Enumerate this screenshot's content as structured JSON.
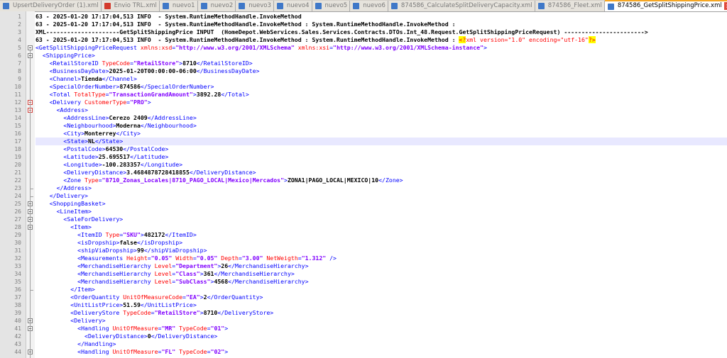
{
  "tabs": [
    {
      "label": "UpsertDeliveryOrder (1).xml",
      "state": "saved"
    },
    {
      "label": "Envio TRL.xml",
      "state": "dirty"
    },
    {
      "label": "nuevo1",
      "state": "saved"
    },
    {
      "label": "nuevo2",
      "state": "saved"
    },
    {
      "label": "nuevo3",
      "state": "saved"
    },
    {
      "label": "nuevo4",
      "state": "saved"
    },
    {
      "label": "nuevo5",
      "state": "saved"
    },
    {
      "label": "nuevo6",
      "state": "saved"
    },
    {
      "label": "874586_CalculateSplitDeliveryCapacity.xml",
      "state": "saved"
    },
    {
      "label": "874586_Fleet.xml",
      "state": "saved"
    },
    {
      "label": "874586_GetSplitShippingPrice.xml",
      "state": "saved",
      "active": true
    }
  ],
  "editor": {
    "highlighted_line": 17,
    "lines": [
      [
        {
          "c": "plain",
          "t": "63 - 2025-01-20 17:17:04,513 INFO  - System.RuntimeMethodHandle.InvokeMethod"
        }
      ],
      [
        {
          "c": "plain",
          "t": "63 - 2025-01-20 17:17:04,513 INFO  - System.RuntimeMethodHandle.InvokeMethod : System.RuntimeMethodHandle.InvokeMethod :"
        }
      ],
      [
        {
          "c": "plain",
          "t": "XML---------------------GetSplitShippingPrice INPUT  (HomeDepot.WebServices.Sales.Services.Contracts.DTOs.Int_48.Request.GetSplitShippingPriceRequest) ----------------------->"
        }
      ],
      [
        {
          "c": "plain",
          "t": "63 - 2025-01-20 17:17:04,513 INFO  - System.RuntimeMethodHandle.InvokeMethod : System.RuntimeMethodHandle.InvokeMethod : "
        },
        {
          "c": "pi",
          "t": "<?"
        },
        {
          "c": "pitxt",
          "t": "xml version=\"1.0\" encoding=\"utf-16\""
        },
        {
          "c": "pi",
          "t": "?>"
        }
      ],
      [
        {
          "c": "tag",
          "t": "<GetSplitShippingPriceRequest "
        },
        {
          "c": "attr",
          "t": "xmlns:xsd"
        },
        {
          "c": "tag",
          "t": "="
        },
        {
          "c": "val",
          "t": "\"http://www.w3.org/2001/XMLSchema\""
        },
        {
          "c": "attr",
          "t": " xmlns:xsi"
        },
        {
          "c": "tag",
          "t": "="
        },
        {
          "c": "val",
          "t": "\"http://www.w3.org/2001/XMLSchema-instance\""
        },
        {
          "c": "tag",
          "t": ">"
        }
      ],
      [
        {
          "c": "tag",
          "t": "  <ShippingPrice>"
        }
      ],
      [
        {
          "c": "tag",
          "t": "    <RetailStoreID "
        },
        {
          "c": "attr",
          "t": "TypeCode"
        },
        {
          "c": "tag",
          "t": "="
        },
        {
          "c": "val",
          "t": "\"RetailStore\""
        },
        {
          "c": "tag",
          "t": ">"
        },
        {
          "c": "text",
          "t": "8710"
        },
        {
          "c": "tag",
          "t": "</RetailStoreID>"
        }
      ],
      [
        {
          "c": "tag",
          "t": "    <BusinessDayDate>"
        },
        {
          "c": "text",
          "t": "2025-01-20T00:00:00-06:00"
        },
        {
          "c": "tag",
          "t": "</BusinessDayDate>"
        }
      ],
      [
        {
          "c": "tag",
          "t": "    <Channel>"
        },
        {
          "c": "text",
          "t": "Tienda"
        },
        {
          "c": "tag",
          "t": "</Channel>"
        }
      ],
      [
        {
          "c": "tag",
          "t": "    <SpecialOrderNumber>"
        },
        {
          "c": "text",
          "t": "874586"
        },
        {
          "c": "tag",
          "t": "</SpecialOrderNumber>"
        }
      ],
      [
        {
          "c": "tag",
          "t": "    <Total "
        },
        {
          "c": "attr",
          "t": "TotalType"
        },
        {
          "c": "tag",
          "t": "="
        },
        {
          "c": "val",
          "t": "\"TransactionGrandAmount\""
        },
        {
          "c": "tag",
          "t": ">"
        },
        {
          "c": "text",
          "t": "3892.28"
        },
        {
          "c": "tag",
          "t": "</Total>"
        }
      ],
      [
        {
          "c": "tag",
          "t": "    <Delivery "
        },
        {
          "c": "attr",
          "t": "CustomerType"
        },
        {
          "c": "tag",
          "t": "="
        },
        {
          "c": "val",
          "t": "\"PRO\""
        },
        {
          "c": "tag",
          "t": ">"
        }
      ],
      [
        {
          "c": "tag",
          "t": "      <Address>"
        }
      ],
      [
        {
          "c": "tag",
          "t": "        <AddressLine>"
        },
        {
          "c": "text",
          "t": "Cerezo 2409"
        },
        {
          "c": "tag",
          "t": "</AddressLine>"
        }
      ],
      [
        {
          "c": "tag",
          "t": "        <Neighbourhood>"
        },
        {
          "c": "text",
          "t": "Moderna"
        },
        {
          "c": "tag",
          "t": "</Neighbourhood>"
        }
      ],
      [
        {
          "c": "tag",
          "t": "        <City>"
        },
        {
          "c": "text",
          "t": "Monterrey"
        },
        {
          "c": "tag",
          "t": "</City>"
        }
      ],
      [
        {
          "c": "tag",
          "t": "        <State>"
        },
        {
          "c": "text",
          "t": "NL"
        },
        {
          "c": "tag",
          "t": "</State>"
        }
      ],
      [
        {
          "c": "tag",
          "t": "        <PostalCode>"
        },
        {
          "c": "text",
          "t": "64530"
        },
        {
          "c": "tag",
          "t": "</PostalCode>"
        }
      ],
      [
        {
          "c": "tag",
          "t": "        <Latitude>"
        },
        {
          "c": "text",
          "t": "25.695517"
        },
        {
          "c": "tag",
          "t": "</Latitude>"
        }
      ],
      [
        {
          "c": "tag",
          "t": "        <Longitude>"
        },
        {
          "c": "text",
          "t": "-100.283357"
        },
        {
          "c": "tag",
          "t": "</Longitude>"
        }
      ],
      [
        {
          "c": "tag",
          "t": "        <DeliveryDistance>"
        },
        {
          "c": "text",
          "t": "3.4684878728418855"
        },
        {
          "c": "tag",
          "t": "</DeliveryDistance>"
        }
      ],
      [
        {
          "c": "tag",
          "t": "        <Zone "
        },
        {
          "c": "attr",
          "t": "Type"
        },
        {
          "c": "tag",
          "t": "="
        },
        {
          "c": "val",
          "t": "\"8710_Zonas_Locales|8710_PAGO_LOCAL|Mexico|Mercados\""
        },
        {
          "c": "tag",
          "t": ">"
        },
        {
          "c": "text",
          "t": "ZONA1|PAGO_LOCAL|MEXICO|10"
        },
        {
          "c": "tag",
          "t": "</Zone>"
        }
      ],
      [
        {
          "c": "tag",
          "t": "      </Address>"
        }
      ],
      [
        {
          "c": "tag",
          "t": "    </Delivery>"
        }
      ],
      [
        {
          "c": "tag",
          "t": "    <ShoppingBasket>"
        }
      ],
      [
        {
          "c": "tag",
          "t": "      <LineItem>"
        }
      ],
      [
        {
          "c": "tag",
          "t": "        <SaleForDelivery>"
        }
      ],
      [
        {
          "c": "tag",
          "t": "          <Item>"
        }
      ],
      [
        {
          "c": "tag",
          "t": "            <ItemID "
        },
        {
          "c": "attr",
          "t": "Type"
        },
        {
          "c": "tag",
          "t": "="
        },
        {
          "c": "val",
          "t": "\"SKU\""
        },
        {
          "c": "tag",
          "t": ">"
        },
        {
          "c": "text",
          "t": "482172"
        },
        {
          "c": "tag",
          "t": "</ItemID>"
        }
      ],
      [
        {
          "c": "tag",
          "t": "            <isDropship>"
        },
        {
          "c": "text",
          "t": "false"
        },
        {
          "c": "tag",
          "t": "</isDropship>"
        }
      ],
      [
        {
          "c": "tag",
          "t": "            <shipViaDropship>"
        },
        {
          "c": "text",
          "t": "99"
        },
        {
          "c": "tag",
          "t": "</shipViaDropship>"
        }
      ],
      [
        {
          "c": "tag",
          "t": "            <Measurements "
        },
        {
          "c": "attr",
          "t": "Height"
        },
        {
          "c": "tag",
          "t": "="
        },
        {
          "c": "val",
          "t": "\"0.05\""
        },
        {
          "c": "attr",
          "t": " Width"
        },
        {
          "c": "tag",
          "t": "="
        },
        {
          "c": "val",
          "t": "\"0.05\""
        },
        {
          "c": "attr",
          "t": " Depth"
        },
        {
          "c": "tag",
          "t": "="
        },
        {
          "c": "val",
          "t": "\"3.00\""
        },
        {
          "c": "attr",
          "t": " NetWeigth"
        },
        {
          "c": "tag",
          "t": "="
        },
        {
          "c": "val",
          "t": "\"1.312\""
        },
        {
          "c": "tag",
          "t": " />"
        }
      ],
      [
        {
          "c": "tag",
          "t": "            <MerchandiseHierarchy "
        },
        {
          "c": "attr",
          "t": "Level"
        },
        {
          "c": "tag",
          "t": "="
        },
        {
          "c": "val",
          "t": "\"Department\""
        },
        {
          "c": "tag",
          "t": ">"
        },
        {
          "c": "text",
          "t": "26"
        },
        {
          "c": "tag",
          "t": "</MerchandiseHierarchy>"
        }
      ],
      [
        {
          "c": "tag",
          "t": "            <MerchandiseHierarchy "
        },
        {
          "c": "attr",
          "t": "Level"
        },
        {
          "c": "tag",
          "t": "="
        },
        {
          "c": "val",
          "t": "\"Class\""
        },
        {
          "c": "tag",
          "t": ">"
        },
        {
          "c": "text",
          "t": "361"
        },
        {
          "c": "tag",
          "t": "</MerchandiseHierarchy>"
        }
      ],
      [
        {
          "c": "tag",
          "t": "            <MerchandiseHierarchy "
        },
        {
          "c": "attr",
          "t": "Level"
        },
        {
          "c": "tag",
          "t": "="
        },
        {
          "c": "val",
          "t": "\"SubClass\""
        },
        {
          "c": "tag",
          "t": ">"
        },
        {
          "c": "text",
          "t": "4568"
        },
        {
          "c": "tag",
          "t": "</MerchandiseHierarchy>"
        }
      ],
      [
        {
          "c": "tag",
          "t": "          </Item>"
        }
      ],
      [
        {
          "c": "tag",
          "t": "          <OrderQuantity "
        },
        {
          "c": "attr",
          "t": "UnitOfMeasureCode"
        },
        {
          "c": "tag",
          "t": "="
        },
        {
          "c": "val",
          "t": "\"EA\""
        },
        {
          "c": "tag",
          "t": ">"
        },
        {
          "c": "text",
          "t": "2"
        },
        {
          "c": "tag",
          "t": "</OrderQuantity>"
        }
      ],
      [
        {
          "c": "tag",
          "t": "          <UnitListPrice>"
        },
        {
          "c": "text",
          "t": "51.59"
        },
        {
          "c": "tag",
          "t": "</UnitListPrice>"
        }
      ],
      [
        {
          "c": "tag",
          "t": "          <DeliveryStore "
        },
        {
          "c": "attr",
          "t": "TypeCode"
        },
        {
          "c": "tag",
          "t": "="
        },
        {
          "c": "val",
          "t": "\"RetailStore\""
        },
        {
          "c": "tag",
          "t": ">"
        },
        {
          "c": "text",
          "t": "8710"
        },
        {
          "c": "tag",
          "t": "</DeliveryStore>"
        }
      ],
      [
        {
          "c": "tag",
          "t": "          <Delivery>"
        }
      ],
      [
        {
          "c": "tag",
          "t": "            <Handling "
        },
        {
          "c": "attr",
          "t": "UnitOfMeasure"
        },
        {
          "c": "tag",
          "t": "="
        },
        {
          "c": "val",
          "t": "\"MR\""
        },
        {
          "c": "attr",
          "t": " TypeCode"
        },
        {
          "c": "tag",
          "t": "="
        },
        {
          "c": "val",
          "t": "\"01\""
        },
        {
          "c": "tag",
          "t": ">"
        }
      ],
      [
        {
          "c": "tag",
          "t": "              <DeliveryDistance>"
        },
        {
          "c": "text",
          "t": "0"
        },
        {
          "c": "tag",
          "t": "</DeliveryDistance>"
        }
      ],
      [
        {
          "c": "tag",
          "t": "            </Handling>"
        }
      ],
      [
        {
          "c": "tag",
          "t": "            <Handling "
        },
        {
          "c": "attr",
          "t": "UnitOfMeasure"
        },
        {
          "c": "tag",
          "t": "="
        },
        {
          "c": "val",
          "t": "\"FL\""
        },
        {
          "c": "attr",
          "t": " TypeCode"
        },
        {
          "c": "tag",
          "t": "="
        },
        {
          "c": "val",
          "t": "\"02\""
        },
        {
          "c": "tag",
          "t": ">"
        }
      ]
    ]
  }
}
